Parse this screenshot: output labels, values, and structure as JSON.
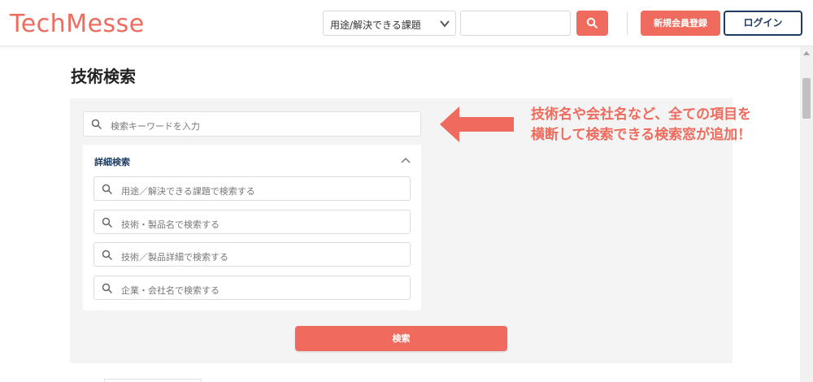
{
  "header": {
    "logo": "TechMesse",
    "category_select": {
      "value": "用途/解決できる課題"
    },
    "search_value": "",
    "register_label": "新規会員登録",
    "login_label": "ログイン"
  },
  "page": {
    "title": "技術検索",
    "keyword_placeholder": "検索キーワードを入力",
    "detail": {
      "title": "詳細検索",
      "fields": [
        "用途／解決できる課題で検索する",
        "技術・製品名で検索する",
        "技術／製品詳細で検索する",
        "企業・会社名で検索する"
      ]
    },
    "search_button": "検索"
  },
  "annotation": {
    "line1": "技術名や会社名など、全ての項目を",
    "line2": "横断して検索できる検索窓が追加！"
  },
  "colors": {
    "accent": "#ef6b5d",
    "navy": "#1e3a5f",
    "panel": "#f4f4f4"
  },
  "icons": [
    "search-icon",
    "chevron-down-icon",
    "chevron-up-icon",
    "arrow-left-icon"
  ]
}
